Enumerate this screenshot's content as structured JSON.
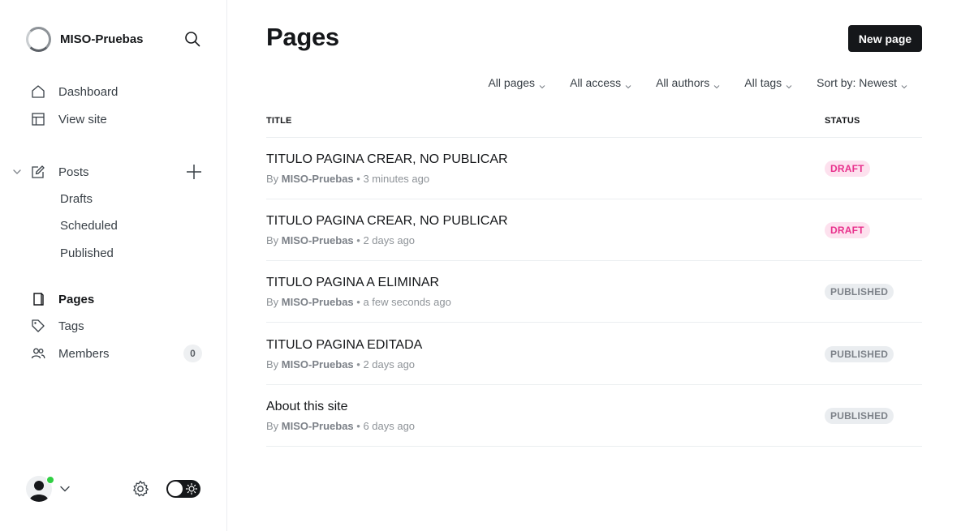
{
  "sidebar": {
    "site_name": "MISO-Pruebas",
    "nav": [
      {
        "label": "Dashboard",
        "icon": "home-icon"
      },
      {
        "label": "View site",
        "icon": "layout-icon"
      }
    ],
    "posts": {
      "label": "Posts",
      "icon": "edit-icon",
      "sub_items": [
        "Drafts",
        "Scheduled",
        "Published"
      ]
    },
    "pages_label": "Pages",
    "tags_label": "Tags",
    "members_label": "Members",
    "members_count": "0"
  },
  "main": {
    "title": "Pages",
    "new_page_label": "New page",
    "filters": [
      "All pages",
      "All access",
      "All authors",
      "All tags",
      "Sort by: Newest"
    ],
    "columns": {
      "title": "TITLE",
      "status": "STATUS"
    },
    "rows": [
      {
        "title": "TITULO PAGINA CREAR, NO PUBLICAR",
        "by": "By",
        "author": "MISO-Pruebas",
        "time": "3 minutes ago",
        "status": "DRAFT"
      },
      {
        "title": "TITULO PAGINA CREAR, NO PUBLICAR",
        "by": "By",
        "author": "MISO-Pruebas",
        "time": "2 days ago",
        "status": "DRAFT"
      },
      {
        "title": "TITULO PAGINA A ELIMINAR",
        "by": "By",
        "author": "MISO-Pruebas",
        "time": "a few seconds ago",
        "status": "PUBLISHED"
      },
      {
        "title": "TITULO PAGINA EDITADA",
        "by": "By",
        "author": "MISO-Pruebas",
        "time": "2 days ago",
        "status": "PUBLISHED"
      },
      {
        "title": "About this site",
        "by": "By",
        "author": "MISO-Pruebas",
        "time": "6 days ago",
        "status": "PUBLISHED"
      }
    ]
  },
  "colors": {
    "accent": "#15171a",
    "draft_bg": "#fde1ee",
    "draft_text": "#e8308c",
    "published_bg": "#eaedf0",
    "published_text": "#7c8188",
    "online": "#30cf43"
  }
}
